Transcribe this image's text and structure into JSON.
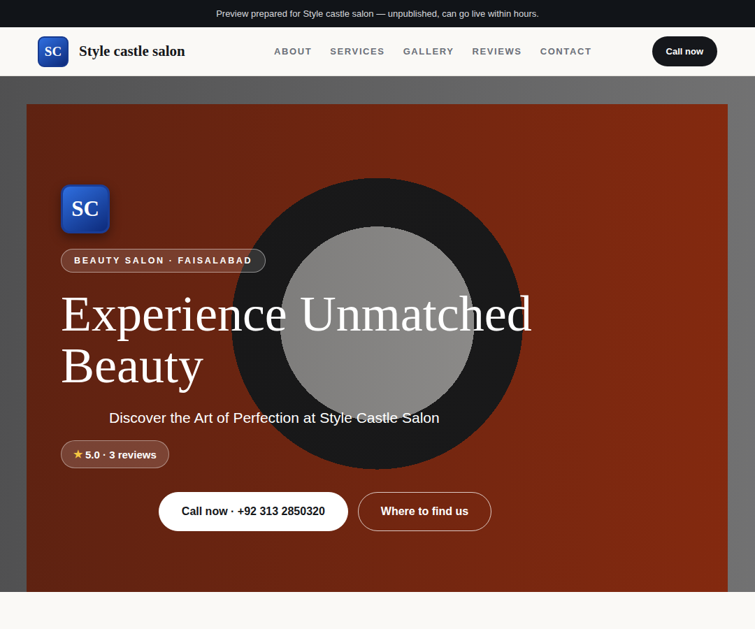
{
  "banner": {
    "text": "Preview prepared for Style castle salon — unpublished, can go live within hours."
  },
  "brand": {
    "initials": "SC",
    "name": "Style castle salon"
  },
  "nav": {
    "links": [
      {
        "label": "ABOUT",
        "selected": false
      },
      {
        "label": "SERVICES",
        "selected": false
      },
      {
        "label": "GALLERY",
        "selected": false
      },
      {
        "label": "REVIEWS",
        "selected": false
      },
      {
        "label": "CONTACT",
        "selected": false
      }
    ],
    "cta": "Call now"
  },
  "hero": {
    "initials": "SC",
    "badge": "BEAUTY SALON · FAISALABAD",
    "title": "Experience Unmatched Beauty",
    "subtitle": "Discover the Art of Perfection at Style Castle Salon",
    "rating": {
      "icon": "★",
      "text": "5.0 · 3 reviews"
    },
    "buttons": [
      {
        "label": "Call now · +92 313 2850320",
        "kind": "primary"
      },
      {
        "label": "Where to find us",
        "kind": "outline"
      }
    ]
  }
}
